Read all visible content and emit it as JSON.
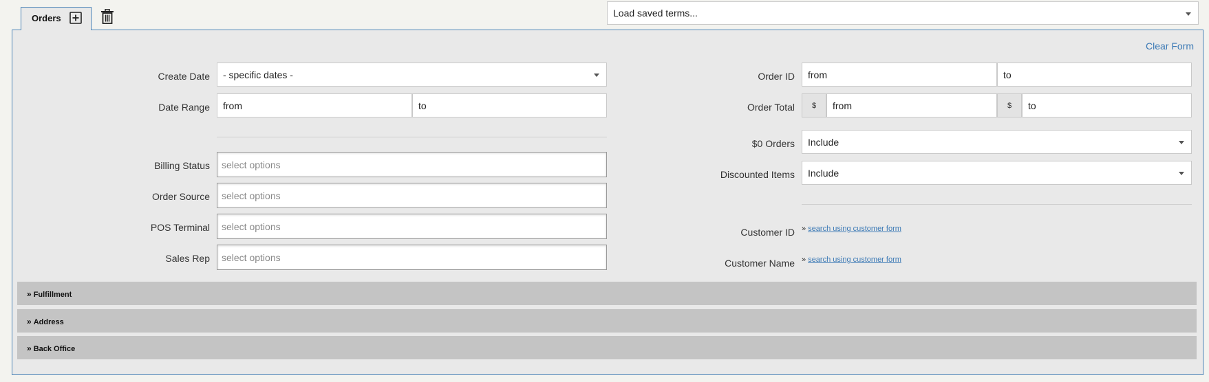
{
  "tab": {
    "label": "Orders"
  },
  "saved_terms": {
    "placeholder": "Load saved terms..."
  },
  "clear_form": "Clear Form",
  "left": {
    "create_date": {
      "label": "Create Date",
      "value": "- specific dates -"
    },
    "date_range": {
      "label": "Date Range",
      "from": "from",
      "to": "to"
    },
    "billing_status": {
      "label": "Billing Status",
      "placeholder": "select options"
    },
    "order_source": {
      "label": "Order Source",
      "placeholder": "select options"
    },
    "pos_terminal": {
      "label": "POS Terminal",
      "placeholder": "select options"
    },
    "sales_rep": {
      "label": "Sales Rep",
      "placeholder": "select options"
    }
  },
  "right": {
    "order_id": {
      "label": "Order ID",
      "from": "from",
      "to": "to"
    },
    "order_total": {
      "label": "Order Total",
      "currency": "$",
      "from": "from",
      "to": "to"
    },
    "zero_orders": {
      "label": "$0 Orders",
      "value": "Include"
    },
    "discounted_items": {
      "label": "Discounted Items",
      "value": "Include"
    },
    "customer_id": {
      "label": "Customer ID",
      "prefix": "»",
      "link": "search using customer form"
    },
    "customer_name": {
      "label": "Customer Name",
      "prefix": "»",
      "link": "search using customer form"
    }
  },
  "sections": [
    {
      "label": "Fulfillment"
    },
    {
      "label": "Address"
    },
    {
      "label": "Back Office"
    }
  ],
  "colors": {
    "accent": "#4c84b8",
    "link": "#3b79b5",
    "section_bg": "#c4c4c4"
  }
}
